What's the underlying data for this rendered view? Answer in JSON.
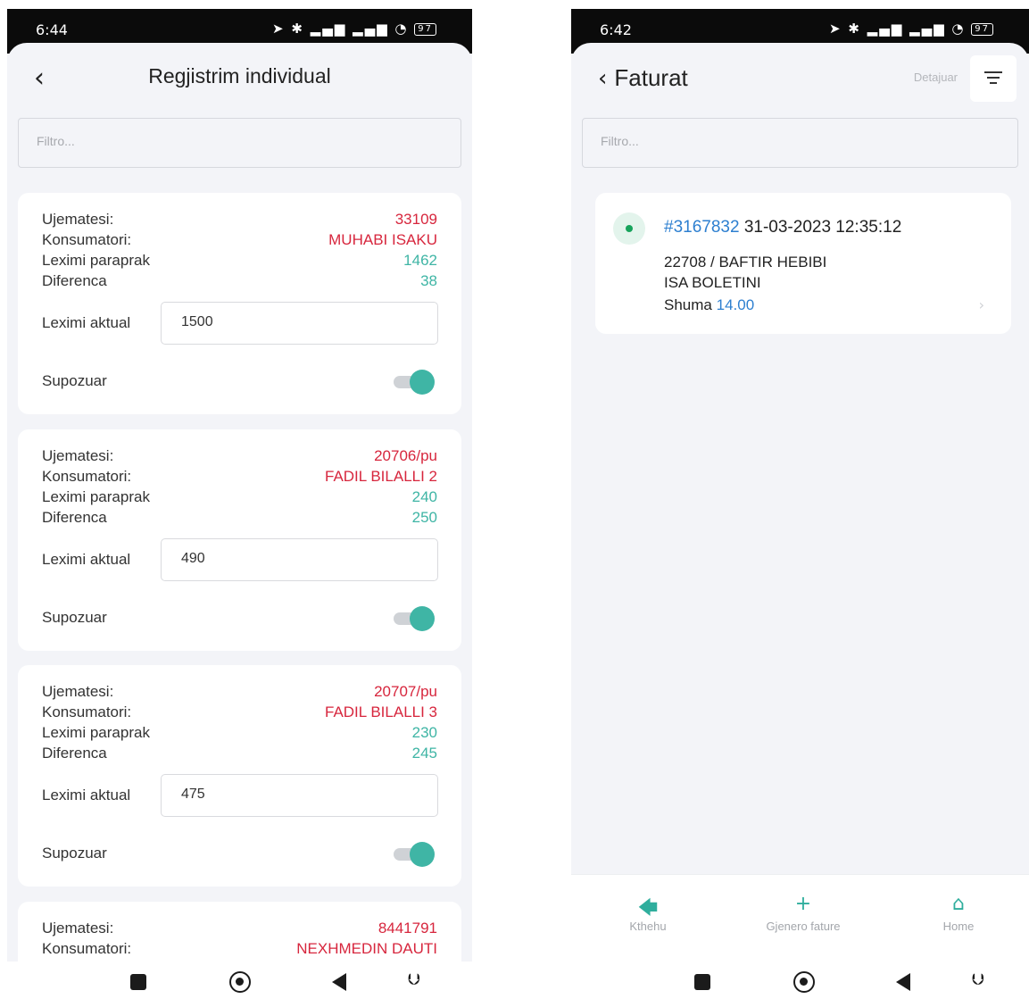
{
  "left_phone": {
    "status": {
      "time": "6:44",
      "battery": "97"
    },
    "title": "Regjistrim individual",
    "filter_placeholder": "Filtro...",
    "labels": {
      "ujemates": "Ujematesi:",
      "konsumator": "Konsumatori:",
      "leximi_paraprak": "Leximi paraprak",
      "diferenca": "Diferenca",
      "leximi_aktual": "Leximi aktual",
      "supozuar": "Supozuar"
    },
    "cards": [
      {
        "ujemates": "33109",
        "konsumator": "MUHABI ISAKU",
        "leximi_paraprak": "1462",
        "diferenca": "38",
        "leximi_aktual": "1500",
        "supozuar": true
      },
      {
        "ujemates": "20706/pu",
        "konsumator": "FADIL BILALLI 2",
        "leximi_paraprak": "240",
        "diferenca": "250",
        "leximi_aktual": "490",
        "supozuar": true
      },
      {
        "ujemates": "20707/pu",
        "konsumator": "FADIL BILALLI 3",
        "leximi_paraprak": "230",
        "diferenca": "245",
        "leximi_aktual": "475",
        "supozuar": true
      },
      {
        "ujemates": "8441791",
        "konsumator": "NEXHMEDIN DAUTI"
      }
    ]
  },
  "right_phone": {
    "status": {
      "time": "6:42",
      "battery": "97"
    },
    "title": "Faturat",
    "detajuar_label": "Detajuar",
    "filter_placeholder": "Filtro...",
    "invoice": {
      "id": "#3167832",
      "datetime": "31-03-2023 12:35:12",
      "line1": "22708 / BAFTIR HEBIBI",
      "line2": "ISA BOLETINI",
      "amount_label": "Shuma",
      "amount": "14.00"
    },
    "bottom_nav": [
      {
        "icon": "arrow-left-icon",
        "label": "Kthehu"
      },
      {
        "icon": "plus-icon",
        "label": "Gjenero fature"
      },
      {
        "icon": "home-icon",
        "label": "Home"
      }
    ]
  },
  "colors": {
    "accent": "#3fb5a5",
    "danger": "#d7263d",
    "link": "#2d7fd0"
  }
}
